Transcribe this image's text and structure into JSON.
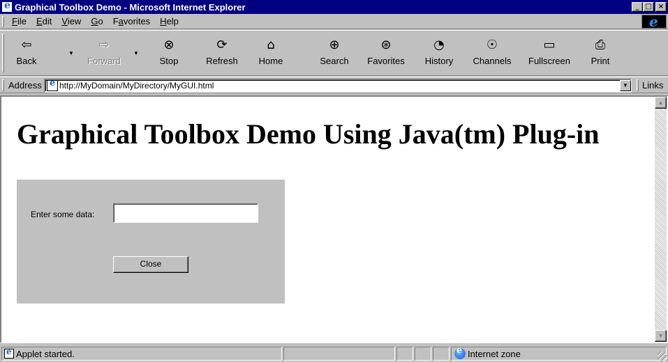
{
  "window": {
    "title": "Graphical Toolbox Demo - Microsoft Internet Explorer",
    "buttons": {
      "minimize": "_",
      "maximize": "□",
      "close": "×"
    }
  },
  "menubar": {
    "items": [
      {
        "label": "File",
        "accel": "F"
      },
      {
        "label": "Edit",
        "accel": "E"
      },
      {
        "label": "View",
        "accel": "V"
      },
      {
        "label": "Go",
        "accel": "G"
      },
      {
        "label": "Favorites",
        "accel": "a"
      },
      {
        "label": "Help",
        "accel": "H"
      }
    ]
  },
  "toolbar": {
    "back": {
      "label": "Back",
      "icon": "back-arrow-icon"
    },
    "forward": {
      "label": "Forward",
      "icon": "forward-arrow-icon"
    },
    "stop": {
      "label": "Stop",
      "icon": "stop-icon"
    },
    "refresh": {
      "label": "Refresh",
      "icon": "refresh-icon"
    },
    "home": {
      "label": "Home",
      "icon": "home-icon"
    },
    "search": {
      "label": "Search",
      "icon": "search-icon"
    },
    "favorites": {
      "label": "Favorites",
      "icon": "favorites-icon"
    },
    "history": {
      "label": "History",
      "icon": "history-icon"
    },
    "channels": {
      "label": "Channels",
      "icon": "channels-icon"
    },
    "fullscreen": {
      "label": "Fullscreen",
      "icon": "fullscreen-icon"
    },
    "print": {
      "label": "Print",
      "icon": "print-icon"
    }
  },
  "addressbar": {
    "label": "Address",
    "url": "http://MyDomain/MyDirectory/MyGUI.html",
    "links_label": "Links"
  },
  "page": {
    "heading": "Graphical Toolbox Demo Using Java(tm) Plug-in",
    "applet": {
      "input_label": "Enter some data:",
      "input_value": "",
      "close_label": "Close"
    }
  },
  "statusbar": {
    "text": "Applet started.",
    "zone": "Internet zone"
  },
  "colors": {
    "titlebar": "#000080",
    "chrome": "#c0c0c0",
    "page_background": "#ffffff"
  }
}
